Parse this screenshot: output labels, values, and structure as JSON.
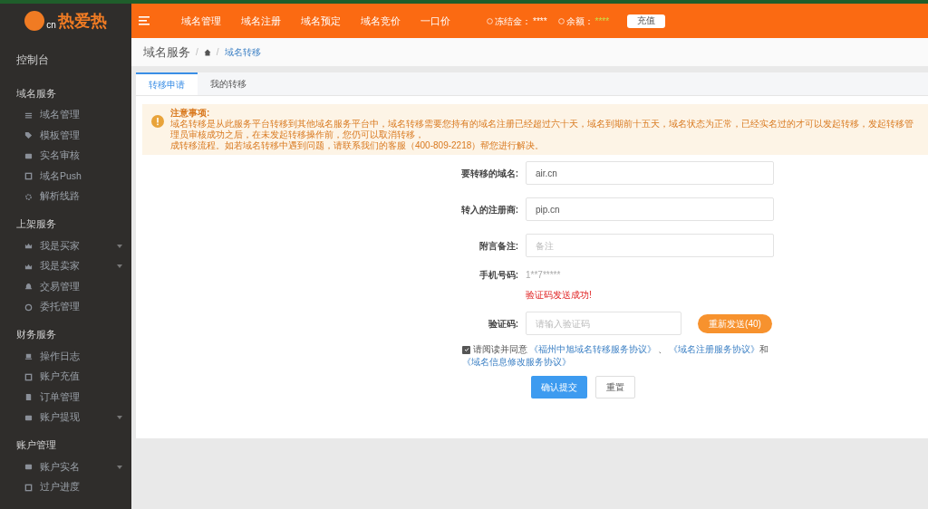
{
  "logo": {
    "text": "热爱热",
    "badge": "cn"
  },
  "top_nav": [
    "域名管理",
    "域名注册",
    "域名预定",
    "域名竞价",
    "一口价"
  ],
  "account": {
    "frozen_label": "冻结金：",
    "frozen_value": "****",
    "balance_label": "余额：",
    "balance_value": "****",
    "recharge_button": "充值"
  },
  "sidebar": {
    "top_item": "控制台",
    "sections": [
      {
        "title": "域名服务",
        "items": [
          {
            "label": "域名管理",
            "kind": "list",
            "expandable": false
          },
          {
            "label": "模板管理",
            "kind": "tag",
            "expandable": false
          },
          {
            "label": "实名审核",
            "kind": "card",
            "expandable": false
          },
          {
            "label": "域名Push",
            "kind": "square",
            "expandable": false
          },
          {
            "label": "解析线路",
            "kind": "gear",
            "expandable": false
          }
        ]
      },
      {
        "title": "上架服务",
        "items": [
          {
            "label": "我是买家",
            "kind": "crown",
            "expandable": true
          },
          {
            "label": "我是卖家",
            "kind": "crown",
            "expandable": true
          },
          {
            "label": "交易管理",
            "kind": "bell",
            "expandable": false
          },
          {
            "label": "委托管理",
            "kind": "circle",
            "expandable": false
          }
        ]
      },
      {
        "title": "财务服务",
        "items": [
          {
            "label": "操作日志",
            "kind": "laptop",
            "expandable": false
          },
          {
            "label": "账户充值",
            "kind": "square",
            "expandable": false
          },
          {
            "label": "订单管理",
            "kind": "file",
            "expandable": false
          },
          {
            "label": "账户提现",
            "kind": "card",
            "expandable": true
          }
        ]
      },
      {
        "title": "账户管理",
        "items": [
          {
            "label": "账户实名",
            "kind": "card",
            "expandable": true
          },
          {
            "label": "过户进度",
            "kind": "square",
            "expandable": false
          }
        ]
      }
    ]
  },
  "breadcrumb": {
    "title": "域名服务",
    "separators": [
      "/",
      "/"
    ],
    "current": "域名转移"
  },
  "tabs": [
    {
      "label": "转移申请",
      "selected": true
    },
    {
      "label": "我的转移",
      "selected": false
    }
  ],
  "notice": {
    "title": "注意事项:",
    "lines": [
      "域名转移是从此服务平台转移到其他域名服务平台中，域名转移需要您持有的域名注册已经超过六十天，域名到期前十五天，域名状态为正常，已经实名过的才可以发起转移，发起转移管理员审核成功之后，在未发起转移操作前，您仍可以取消转移，",
      "成转移流程。如若域名转移中遇到问题，请联系我们的客服（400-809-2218）帮您进行解决。"
    ]
  },
  "form": {
    "fields": [
      {
        "label": "要转移的域名:",
        "value": "air.cn"
      },
      {
        "label": "转入的注册商:",
        "value": "pip.cn"
      },
      {
        "label": "附言备注:",
        "placeholder": "备注"
      }
    ],
    "phone_label": "手机号码:",
    "phone_value": "1**7*****",
    "success_message": "验证码发送成功!",
    "code_label": "验证码:",
    "code_placeholder": "请输入验证码",
    "resend_button": "重新发送(40)",
    "agree": {
      "checked": true,
      "text": "请阅读并同意",
      "links": [
        "《福州中旭域名转移服务协议》",
        "《域名注册服务协议》",
        "《域名信息修改服务协议》"
      ],
      "separator": "、",
      "conjunction": "和"
    },
    "submit_button": "确认提交",
    "reset_button": "重置"
  }
}
